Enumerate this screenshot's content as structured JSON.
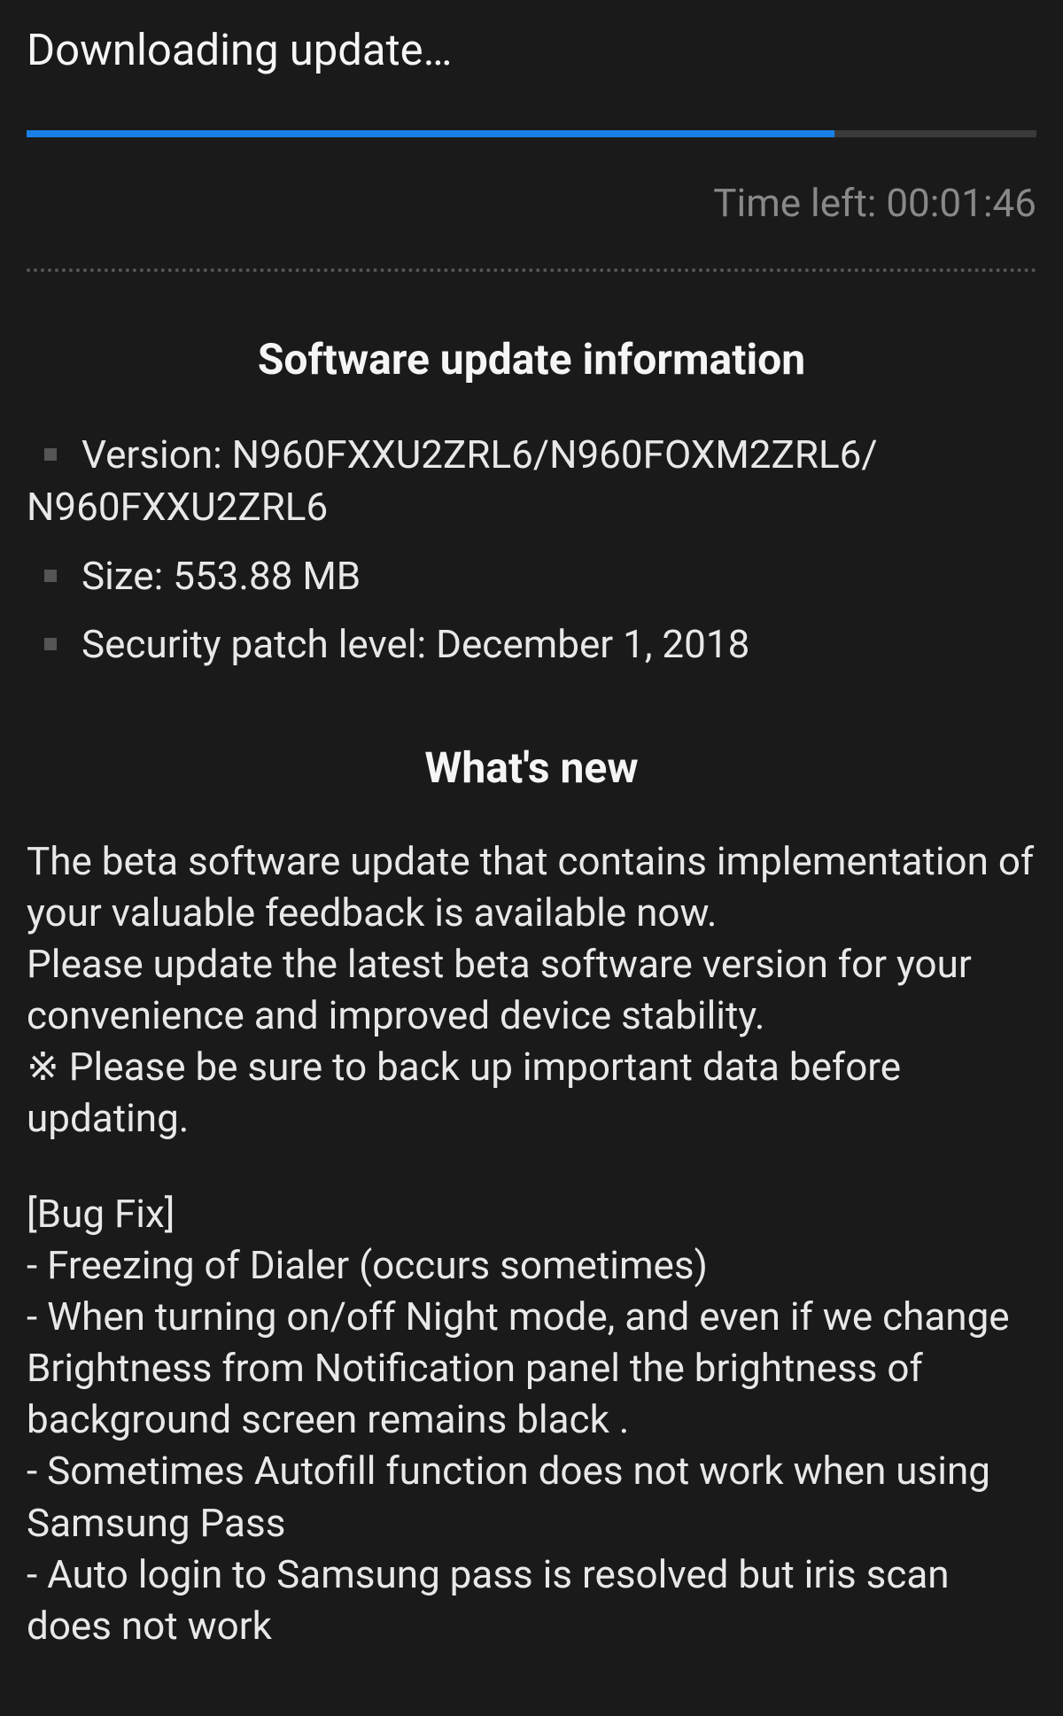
{
  "header": {
    "title": "Downloading update…"
  },
  "progress": {
    "percent": 80,
    "time_left_label": "Time left: 00:01:46"
  },
  "info": {
    "heading": "Software update information",
    "version_label": "Version: N960FXXU2ZRL6/N960FOXM2ZRL6/",
    "version_cont": "N960FXXU2ZRL6",
    "size_label": "Size: 553.88 MB",
    "patch_label": "Security patch level: December 1, 2018"
  },
  "whatsnew": {
    "heading": "What's new",
    "p1": "The beta software update that contains implementation of your valuable feedback is available now.",
    "p2": "Please update the latest beta software version for your convenience and improved device stability.",
    "p3": "※ Please be sure to back up important data before updating.",
    "bugfix_heading": "[Bug Fix]",
    "b1": "- Freezing of Dialer (occurs sometimes)",
    "b2": "- When turning on/off Night mode, and even if we change Brightness from Notification panel the brightness of background screen remains black .",
    "b3": "- Sometimes Autofill function does not work when using Samsung Pass",
    "b4": "- Auto login to Samsung pass is resolved but iris scan does not work"
  }
}
